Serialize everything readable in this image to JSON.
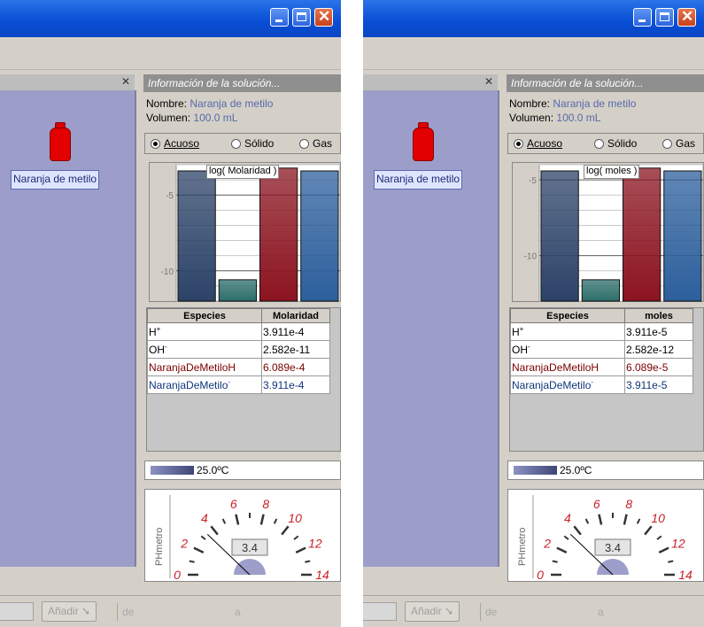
{
  "panels": [
    {
      "info": {
        "header": "Información de la solución...",
        "name_label": "Nombre:",
        "name_value": "Naranja de metilo",
        "volume_label": "Volumen:",
        "volume_value": "100.0 mL"
      },
      "phase_options": [
        "Acuoso",
        "Sólido",
        "Gas"
      ],
      "selected_phase": "Acuoso",
      "bottle_label": "Naranja de metilo",
      "temperature": "25.0ºC",
      "meter": {
        "label": "PHmetro",
        "value": "3.4",
        "reading": 3.4,
        "ticks": [
          "0",
          "2",
          "4",
          "6",
          "8",
          "10",
          "12",
          "14"
        ]
      },
      "bottom": {
        "add_button": "Añadir",
        "de": "de",
        "a": "a"
      },
      "table": {
        "headers": [
          "Especies",
          "Molaridad"
        ],
        "rows": [
          {
            "species": "H",
            "sup": "+",
            "value": "3.911e-4",
            "color": "#000000"
          },
          {
            "species": "OH",
            "sup": "-",
            "value": "2.582e-11",
            "color": "#000000"
          },
          {
            "species": "NaranjaDeMetiloH",
            "sup": "",
            "value": "6.089e-4",
            "color": "#7a0000"
          },
          {
            "species": "NaranjaDeMetilo",
            "sup": "-",
            "value": "3.911e-4",
            "color": "#10357a"
          }
        ]
      },
      "chart_data": {
        "type": "bar",
        "title": "log( Molaridad )",
        "categories": [
          "H+",
          "OH-",
          "NaranjaDeMetiloH",
          "NaranjaDeMetilo-"
        ],
        "values": [
          -3.41,
          -10.59,
          -3.22,
          -3.41
        ],
        "ylim": [
          -12,
          -3
        ],
        "yticks": [
          -5,
          -10
        ],
        "colors": [
          "#2c4368",
          "#2c6e6a",
          "#8b1420",
          "#2c5f9c"
        ]
      }
    },
    {
      "info": {
        "header": "Información de la solución...",
        "name_label": "Nombre:",
        "name_value": "Naranja de metilo",
        "volume_label": "Volumen:",
        "volume_value": "100.0 mL"
      },
      "phase_options": [
        "Acuoso",
        "Sólido",
        "Gas"
      ],
      "selected_phase": "Acuoso",
      "bottle_label": "Naranja de metilo",
      "temperature": "25.0ºC",
      "meter": {
        "label": "PHmetro",
        "value": "3.4",
        "reading": 3.4,
        "ticks": [
          "0",
          "2",
          "4",
          "6",
          "8",
          "10",
          "12",
          "14"
        ]
      },
      "bottom": {
        "add_button": "Añadir",
        "de": "de",
        "a": "a"
      },
      "table": {
        "headers": [
          "Especies",
          "moles"
        ],
        "rows": [
          {
            "species": "H",
            "sup": "+",
            "value": "3.911e-5",
            "color": "#000000"
          },
          {
            "species": "OH",
            "sup": "-",
            "value": "2.582e-12",
            "color": "#000000"
          },
          {
            "species": "NaranjaDeMetiloH",
            "sup": "",
            "value": "6.089e-5",
            "color": "#7a0000"
          },
          {
            "species": "NaranjaDeMetilo",
            "sup": "-",
            "value": "3.911e-5",
            "color": "#10357a"
          }
        ]
      },
      "chart_data": {
        "type": "bar",
        "title": "log( moles )",
        "categories": [
          "H+",
          "OH-",
          "NaranjaDeMetiloH",
          "NaranjaDeMetilo-"
        ],
        "values": [
          -4.41,
          -11.59,
          -4.22,
          -4.41
        ],
        "ylim": [
          -13,
          -4
        ],
        "yticks": [
          -5,
          -10
        ],
        "colors": [
          "#2c4368",
          "#2c6e6a",
          "#8b1420",
          "#2c5f9c"
        ]
      }
    }
  ]
}
